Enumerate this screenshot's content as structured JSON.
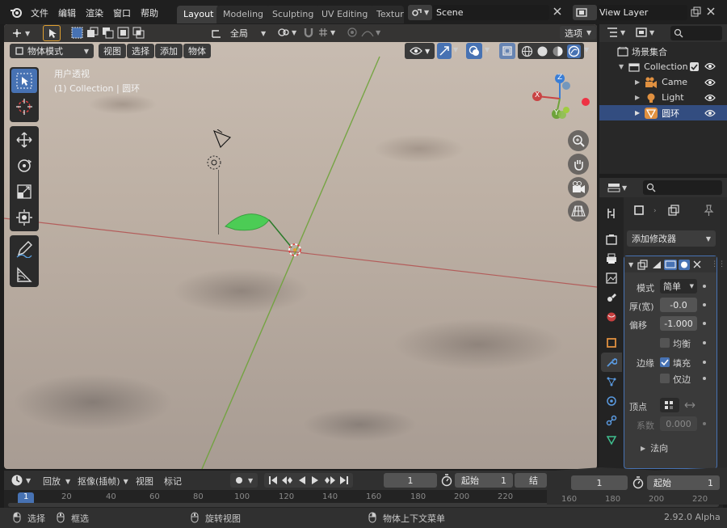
{
  "menu": {
    "file": "文件",
    "edit": "编辑",
    "render": "渲染",
    "window": "窗口",
    "help": "帮助"
  },
  "workspaces": [
    "Layout",
    "Modeling",
    "Sculpting",
    "UV Editing",
    "Texturi"
  ],
  "scene": {
    "name": "Scene",
    "view_layer": "View Layer"
  },
  "viewport": {
    "transform_orientation": "全局",
    "options_label": "选项",
    "mode": "物体模式",
    "menus": [
      "视图",
      "选择",
      "添加",
      "物体"
    ],
    "view_name": "用户透视",
    "collection_info": "(1) Collection | 圆环",
    "gizmo": {
      "x": "X",
      "y": "Y",
      "z": "Z"
    },
    "colors": {
      "x_axis": "#c94444",
      "y_axis": "#6ea33a",
      "z_axis": "#3a7ed6",
      "accent": "#4772b3"
    }
  },
  "outliner": {
    "root": "场景集合",
    "items": [
      {
        "label": "Collection",
        "icon": "collection-icon"
      },
      {
        "label": "Came",
        "icon": "camera-icon"
      },
      {
        "label": "Light",
        "icon": "light-icon"
      },
      {
        "label": "圆环",
        "icon": "mesh-icon"
      }
    ]
  },
  "properties": {
    "add_modifier": "添加修改器",
    "modifier": {
      "mode_label": "模式",
      "mode_value": "简单",
      "thickness_label": "厚(宽)",
      "thickness_value": "-0.0",
      "offset_label": "偏移",
      "offset_value": "-1.000",
      "even_label": "均衡",
      "rim_label": "边缘",
      "fill_label": "填充",
      "only_label": "仅边",
      "vertex_label": "顶点",
      "factor_label": "系数",
      "factor_value": "0.000",
      "normals_label": "法向"
    }
  },
  "timeline": {
    "playback": "回放",
    "keying": "抠像(插帧)",
    "view": "视图",
    "marker": "标记",
    "current_frame": "1",
    "start_label": "起始",
    "start_value": "1",
    "end_label_partial": "结",
    "overlay_frame": "1",
    "overlay_start_label": "起始",
    "overlay_start_value": "1",
    "ruler": [
      "1",
      "20",
      "40",
      "60",
      "80",
      "100",
      "120",
      "140",
      "160",
      "180",
      "200",
      "220"
    ],
    "overlay_ruler": [
      "160",
      "180",
      "200",
      "220"
    ]
  },
  "status": {
    "select": "选择",
    "box_select": "框选",
    "rotate_view": "旋转视图",
    "context_menu": "物体上下文菜单",
    "version": "2.92.0 Alpha"
  }
}
